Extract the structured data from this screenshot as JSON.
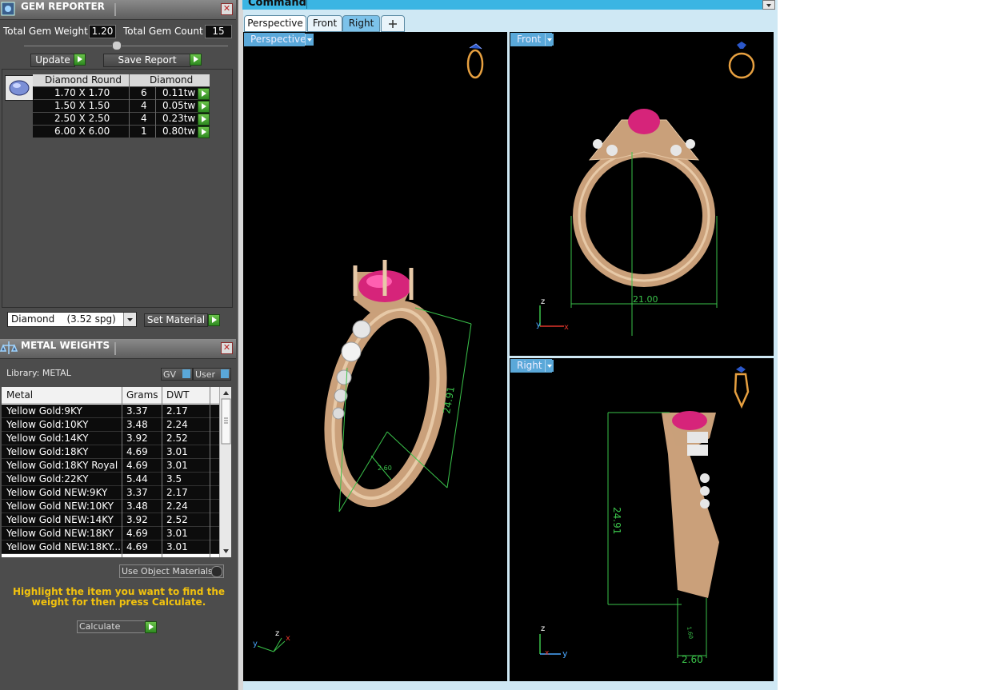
{
  "gem_reporter": {
    "title": "GEM REPORTER",
    "total_weight_label": "Total Gem Weight",
    "total_weight_value": "1.20",
    "total_count_label": "Total Gem Count",
    "total_count_value": "15",
    "update_label": "Update",
    "save_report_label": "Save Report",
    "gem_headers": [
      "Diamond Round",
      "Diamond"
    ],
    "gems": [
      {
        "size": "1.70 X 1.70",
        "count": "6",
        "weight": "0.11tw"
      },
      {
        "size": "1.50 X 1.50",
        "count": "4",
        "weight": "0.05tw"
      },
      {
        "size": "2.50 X 2.50",
        "count": "4",
        "weight": "0.23tw"
      },
      {
        "size": "6.00 X 6.00",
        "count": "1",
        "weight": "0.80tw"
      }
    ],
    "material_select": "Diamond    (3.52 spg)",
    "set_material_label": "Set Material"
  },
  "metal_weights": {
    "title": "METAL WEIGHTS",
    "library_label": "Library: METAL",
    "gv_label": "GV",
    "user_label": "User",
    "columns": [
      "Metal",
      "Grams",
      "DWT"
    ],
    "rows": [
      {
        "metal": "Yellow Gold:9KY",
        "grams": "3.37",
        "dwt": "2.17"
      },
      {
        "metal": "Yellow Gold:10KY",
        "grams": "3.48",
        "dwt": "2.24"
      },
      {
        "metal": "Yellow Gold:14KY",
        "grams": "3.92",
        "dwt": "2.52"
      },
      {
        "metal": "Yellow Gold:18KY",
        "grams": "4.69",
        "dwt": "3.01"
      },
      {
        "metal": "Yellow Gold:18KY Royal",
        "grams": "4.69",
        "dwt": "3.01"
      },
      {
        "metal": "Yellow Gold:22KY",
        "grams": "5.44",
        "dwt": "3.5"
      },
      {
        "metal": "Yellow Gold NEW:9KY",
        "grams": "3.37",
        "dwt": "2.17"
      },
      {
        "metal": "Yellow Gold NEW:10KY",
        "grams": "3.48",
        "dwt": "2.24"
      },
      {
        "metal": "Yellow Gold NEW:14KY",
        "grams": "3.92",
        "dwt": "2.52"
      },
      {
        "metal": "Yellow Gold NEW:18KY",
        "grams": "4.69",
        "dwt": "3.01"
      },
      {
        "metal": "Yellow Gold NEW:18KY...",
        "grams": "4.69",
        "dwt": "3.01"
      }
    ],
    "use_object_materials": "Use Object Materials",
    "hint": "Highlight the item you want to find the weight for then press Calculate.",
    "calculate_label": "Calculate"
  },
  "command": {
    "label": "Command:"
  },
  "tabs": [
    "Perspective",
    "Front",
    "Right"
  ],
  "viewports": {
    "perspective": {
      "label": "Perspective",
      "dim_height": "24.91",
      "dim_small": "2.60"
    },
    "front": {
      "label": "Front",
      "dim_width": "21.00"
    },
    "right": {
      "label": "Right",
      "dim_height": "24.91",
      "dim_small": "2.60",
      "dim_small2": "1.60"
    }
  },
  "axes": {
    "x": "x",
    "y": "y",
    "z": "z"
  },
  "colors": {
    "gold": "#d9b78a",
    "ruby": "#d6247a",
    "dim": "#3ac24a",
    "viewport_label": "#5aa8d9"
  }
}
